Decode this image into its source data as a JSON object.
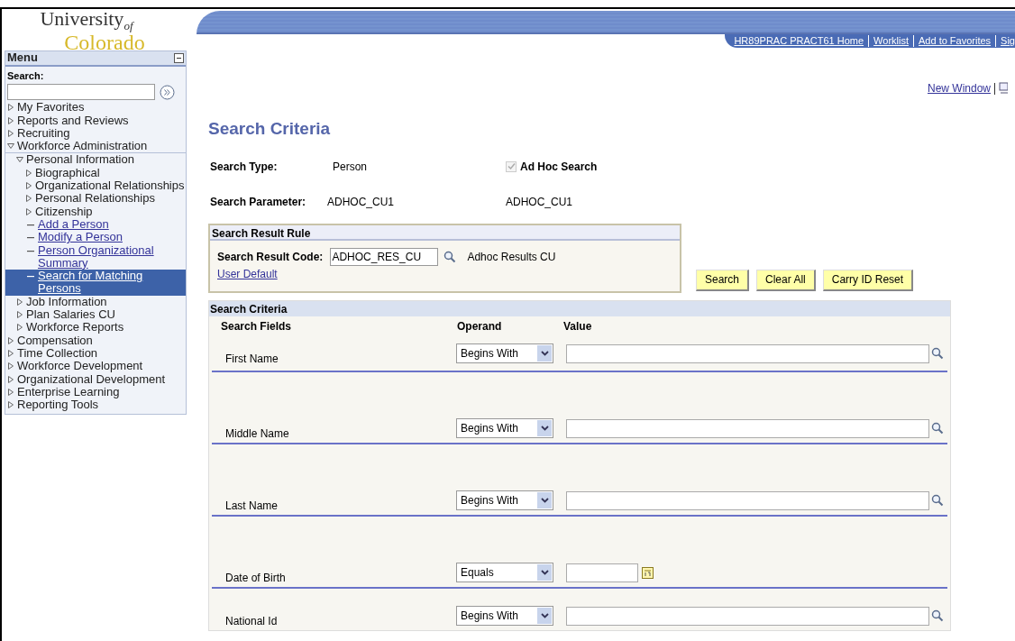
{
  "logo": {
    "line1": "University",
    "of": "of",
    "line2": "Colorado"
  },
  "nav_links": [
    "HR89PRAC PRACT61 Home",
    "Worklist",
    "Add to Favorites",
    "Sig"
  ],
  "new_window": "New Window",
  "menu": {
    "title": "Menu",
    "search_label": "Search:",
    "items": [
      {
        "label": "My Favorites",
        "kind": "folder",
        "expanded": false,
        "selected": false
      },
      {
        "label": "Reports and Reviews",
        "kind": "folder",
        "expanded": false,
        "selected": false
      },
      {
        "label": "Recruiting",
        "kind": "folder",
        "expanded": false,
        "selected": false
      },
      {
        "label": "Workforce Administration",
        "kind": "folder",
        "expanded": true,
        "selected": false,
        "children": [
          {
            "label": "Personal Information",
            "kind": "folder",
            "expanded": true,
            "selected": false,
            "children": [
              {
                "label": "Biographical",
                "kind": "folder",
                "expanded": false,
                "selected": false
              },
              {
                "label": "Organizational Relationships",
                "kind": "folder",
                "expanded": false,
                "selected": false
              },
              {
                "label": "Personal Relationships",
                "kind": "folder",
                "expanded": false,
                "selected": false
              },
              {
                "label": "Citizenship",
                "kind": "folder",
                "expanded": false,
                "selected": false
              },
              {
                "label": "Add a Person",
                "kind": "link",
                "selected": false
              },
              {
                "label": "Modify a Person",
                "kind": "link",
                "selected": false
              },
              {
                "label": "Person Organizational Summary",
                "kind": "link",
                "selected": false
              },
              {
                "label": "Search for Matching Persons",
                "kind": "link",
                "selected": true
              }
            ]
          },
          {
            "label": "Job Information",
            "kind": "folder",
            "expanded": false,
            "selected": false
          },
          {
            "label": "Plan Salaries CU",
            "kind": "folder",
            "expanded": false,
            "selected": false
          },
          {
            "label": "Workforce Reports",
            "kind": "folder",
            "expanded": false,
            "selected": false
          }
        ]
      },
      {
        "label": "Compensation",
        "kind": "folder",
        "expanded": false,
        "selected": false
      },
      {
        "label": "Time Collection",
        "kind": "folder",
        "expanded": false,
        "selected": false
      },
      {
        "label": "Workforce Development",
        "kind": "folder",
        "expanded": false,
        "selected": false
      },
      {
        "label": "Organizational Development",
        "kind": "folder",
        "expanded": false,
        "selected": false
      },
      {
        "label": "Enterprise Learning",
        "kind": "folder",
        "expanded": false,
        "selected": false
      },
      {
        "label": "Reporting Tools",
        "kind": "folder",
        "expanded": false,
        "selected": false
      }
    ]
  },
  "page_title": "Search Criteria",
  "search_type": {
    "label": "Search Type:",
    "value": "Person"
  },
  "ad_hoc": {
    "label": "Ad Hoc Search",
    "checked": true,
    "disabled": true
  },
  "search_parameter": {
    "label": "Search Parameter:",
    "value": "ADHOC_CU1",
    "description": "ADHOC_CU1"
  },
  "result_rule": {
    "title": "Search Result Rule",
    "code_label": "Search Result Code:",
    "code_value": "ADHOC_RES_CU",
    "code_description": "Adhoc Results CU",
    "link": "User Default"
  },
  "buttons": [
    "Search",
    "Clear All",
    "Carry ID Reset"
  ],
  "criteria": {
    "title": "Search Criteria",
    "columns": [
      "Search Fields",
      "Operand",
      "Value"
    ],
    "rows": [
      {
        "field": "First Name",
        "operand": "Begins With",
        "kind": "lookup"
      },
      {
        "field": "Middle Name",
        "operand": "Begins With",
        "kind": "lookup"
      },
      {
        "field": "Last Name",
        "operand": "Begins With",
        "kind": "lookup"
      },
      {
        "field": "Date of Birth",
        "operand": "Equals",
        "kind": "date"
      },
      {
        "field": "National Id",
        "operand": "Begins With",
        "kind": "lookup"
      }
    ]
  }
}
